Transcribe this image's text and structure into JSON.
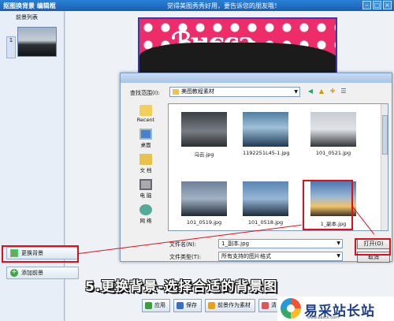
{
  "window": {
    "title": "抠图换背景 编辑框",
    "center_message": "觉得美图秀秀好用，要告诉您的朋友哦！",
    "btn_min": "–",
    "btn_max": "□",
    "btn_close": "×"
  },
  "left_panel": {
    "header": "前景列表",
    "item_number": "1",
    "change_bg_button": "更换背景",
    "add_fg_button": "添加前景"
  },
  "dialog": {
    "look_in_label": "查找范围(I):",
    "look_in_value": "美图教程素材",
    "dropdown_arrow": "▼",
    "places": [
      "Recent",
      "桌面",
      "文 档",
      "电 脑",
      "网 络"
    ],
    "files": [
      {
        "name": "乌云.jpg",
        "tone": "dark-cloud"
      },
      {
        "name": "1192251L45-1.jpg",
        "tone": "blue-sea"
      },
      {
        "name": "101_0521.jpg",
        "tone": "grey-sky"
      },
      {
        "name": "101_0519.jpg",
        "tone": "dusk-sea"
      },
      {
        "name": "101_0518.jpg",
        "tone": "blue-dusk"
      },
      {
        "name": "1_副本.jpg",
        "tone": "sunset"
      }
    ],
    "filename_label": "文件名(N):",
    "filename_value": "1_副本.jpg",
    "filetype_label": "文件类型(T):",
    "filetype_value": "所有支持的图片格式",
    "open_button": "打开(O)",
    "cancel_button": "取消"
  },
  "caption": "5.更换背景-选择合适的背景图",
  "bottom_buttons": {
    "apply": "应用",
    "save": "保存",
    "set_bg": "前景作为素材",
    "clear": "清"
  },
  "watermark": {
    "brand": "易采站长站",
    "url": "www.easck.com"
  },
  "colors": {
    "highlight_red": "#e0101a",
    "title_blue": "#1a5fb4"
  }
}
